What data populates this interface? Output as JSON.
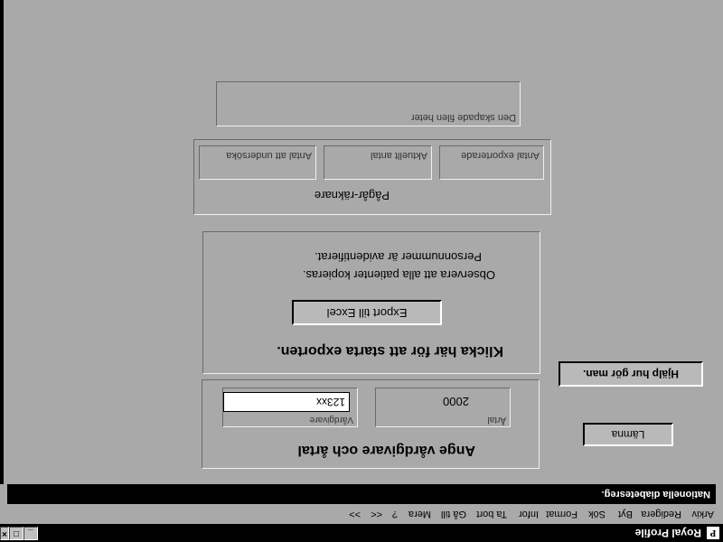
{
  "window": {
    "title": "Royal Profile",
    "icon_letter": "P",
    "minimize": "_",
    "maximize": "□",
    "close": "×"
  },
  "menu": {
    "items": [
      "Arkiv",
      "Redigera",
      "Byt",
      "Sök",
      "Format",
      "Infor",
      "Ta bort",
      "Gå till",
      "Mera",
      "?",
      "<<",
      ">>"
    ]
  },
  "status": {
    "text": "Nationella diabetesreg."
  },
  "form": {
    "heading": "Ange vårdgivare och årtal",
    "caregiver_label": "Vårdgivare",
    "caregiver_value": "123xx",
    "year_label": "Årtal",
    "year_value": "2000",
    "help_button": "Hjälp hur gör man.",
    "leave_button": "Lämna"
  },
  "export": {
    "heading": "Klicka här för att starta exporten.",
    "button": "Export till Excel",
    "note_line1": "Observera att alla patienter kopieras.",
    "note_line2": "Personnummer är avidentifierat."
  },
  "counter": {
    "title": "Pågår-räknare",
    "fields": [
      "Antal att undersöka",
      "Aktuellt antal",
      "Antal exporterade"
    ]
  },
  "file": {
    "label": "Den skapade filen heter"
  }
}
